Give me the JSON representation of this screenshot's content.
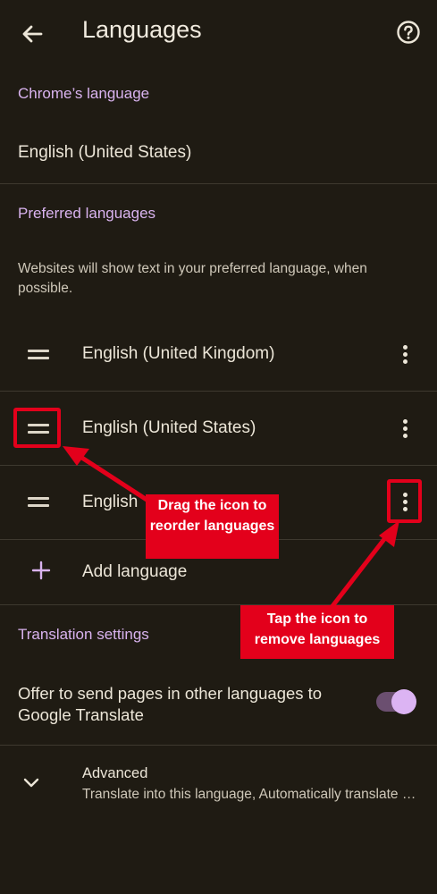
{
  "header": {
    "title": "Languages",
    "back_icon": "arrow-left-icon",
    "help_icon": "help-circle-icon"
  },
  "chrome_language": {
    "section_title": "Chrome’s language",
    "value": "English (United States)"
  },
  "preferred": {
    "section_title": "Preferred languages",
    "description": "Websites will show text in your preferred language, when possible.",
    "items": [
      {
        "label": "English (United Kingdom)"
      },
      {
        "label": "English (United States)"
      },
      {
        "label": "English"
      }
    ],
    "add_label": "Add language"
  },
  "translation": {
    "section_title": "Translation settings",
    "offer_label": "Offer to send pages in other languages to Google Translate",
    "offer_enabled": true
  },
  "advanced": {
    "title": "Advanced",
    "subtitle": "Translate into this language, Automatically translate these languages"
  },
  "annotations": {
    "drag_callout": "Drag the icon to reorder languages",
    "tap_callout": "Tap the icon to remove languages"
  },
  "colors": {
    "background": "#1f1b13",
    "accent": "#d9b3ef",
    "annotation_red": "#e3001b"
  }
}
